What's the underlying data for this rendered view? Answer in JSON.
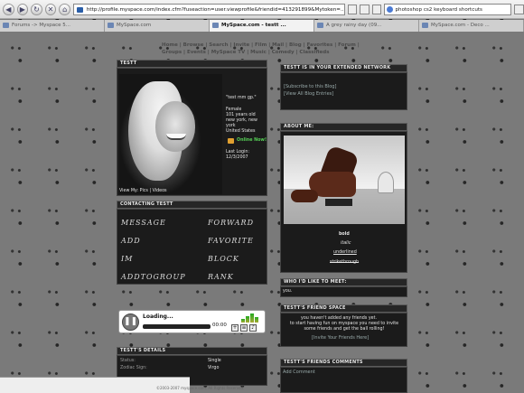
{
  "browser": {
    "url": "http://profile.myspace.com/index.cfm?fuseaction=user.viewprofile&friendid=413291899&Mytoken=...",
    "search_text": "photoshop cs2 keyboard shortcuts",
    "tabs": [
      {
        "label": "Forums -> Myspace 5..."
      },
      {
        "label": "MySpace.com"
      },
      {
        "label": "MySpace.com - testt ..."
      },
      {
        "label": "A grey rainy day (09..."
      },
      {
        "label": "MySpace.com - Deco ..."
      }
    ]
  },
  "nav": {
    "text": "Home | Browse | Search | Invite | Film | Mail | Blog | Favorites | Forum | Groups | Events | MySpace TV | Music | Comedy | Classifieds"
  },
  "profile": {
    "name_header": "TESTT",
    "quote": "\"test mm gp.\"",
    "gender": "Female",
    "age": "101 years old",
    "city": "new york, new",
    "state": "york",
    "country": "United States",
    "online_now": "Online Now!",
    "last_login_label": "Last Login:",
    "last_login": "12/3/2007",
    "view_my": "View My: Pics | Videos"
  },
  "contacting": {
    "header": "CONTACTING TESTT",
    "items": [
      "Message",
      "Forward",
      "Add",
      "Favorite",
      "Im",
      "Block",
      "AddToGroup",
      "Rank"
    ]
  },
  "player": {
    "status": "Loading...",
    "time": "00:00"
  },
  "details": {
    "header": "TESTT'S DETAILS",
    "rows": [
      {
        "label": "Status:",
        "value": "Single"
      },
      {
        "label": "Zodiac Sign:",
        "value": "Virgo"
      }
    ]
  },
  "extended": {
    "header": "TESTT IS IN YOUR EXTENDED NETWORK",
    "subscribe": "[Subscribe to this Blog]",
    "view_all": "[View All Blog Entries]"
  },
  "about": {
    "header": "ABOUT ME:",
    "styles": [
      "bold",
      "italic",
      "underlined",
      "strikethrough"
    ]
  },
  "meet": {
    "header": "WHO I'D LIKE TO MEET:",
    "text": "you."
  },
  "friend_space": {
    "header": "TESTT'S FRIEND SPACE",
    "line1": "you haven't added any friends yet.",
    "line2": "to start having fun on myspace you need to invite some friends and get the ball rolling!",
    "invite": "[Invite Your Friends Here]"
  },
  "comments": {
    "header": "TESTT'S FRIENDS COMMENTS",
    "add": "Add Comment"
  },
  "footer": "©2003-2007 myspace.com. All Rights Reserved."
}
